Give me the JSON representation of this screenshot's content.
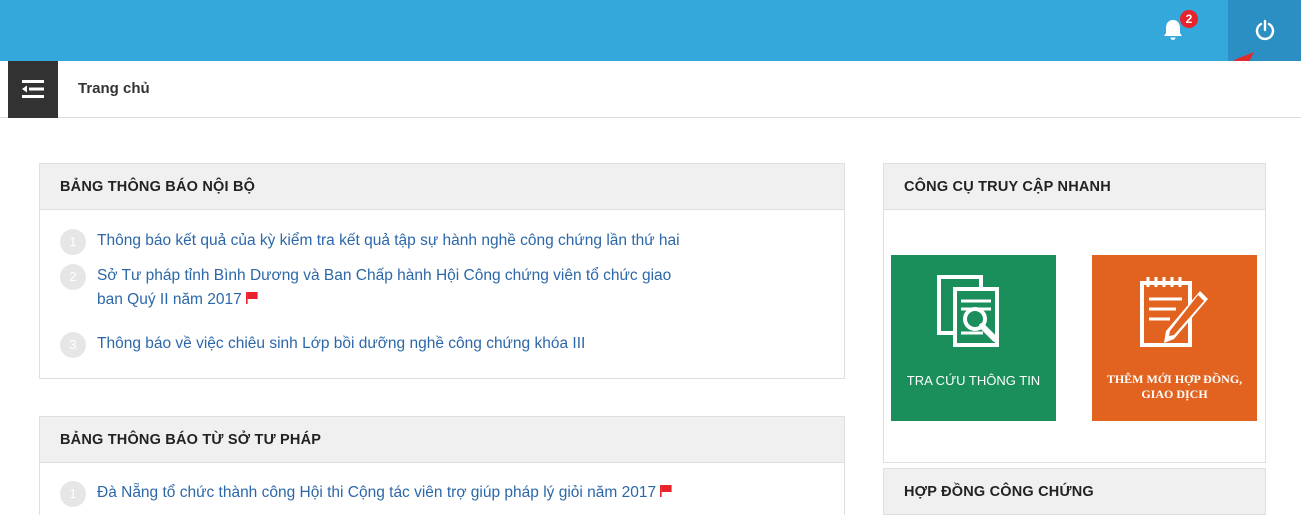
{
  "header": {
    "notification_count": "2"
  },
  "breadcrumb": {
    "title": "Trang chủ"
  },
  "internal_board": {
    "title": "BẢNG THÔNG BÁO NỘI BỘ",
    "items": [
      {
        "num": "1",
        "text": "Thông báo kết quả của kỳ kiểm tra kết quả tập sự hành nghề công chứng lần thứ hai",
        "new": false
      },
      {
        "num": "2",
        "text_line1": "Sở Tư pháp tỉnh Bình Dương và Ban Chấp hành Hội Công chứng viên tổ chức giao",
        "text_line2": "ban Quý II năm 2017",
        "new": true
      },
      {
        "num": "3",
        "text": "Thông báo về việc chiêu sinh Lớp bồi dưỡng nghề công chứng khóa III",
        "new": false
      }
    ]
  },
  "justice_board": {
    "title": "BẢNG THÔNG BÁO TỪ SỞ TƯ PHÁP",
    "items": [
      {
        "num": "1",
        "text": "Đà Nẵng tổ chức thành công Hội thi Cộng tác viên trợ giúp pháp lý giỏi năm 2017",
        "new": true
      }
    ]
  },
  "quick_tools": {
    "title": "CÔNG CỤ TRUY CẬP NHANH",
    "tiles": [
      {
        "label": "TRA CỨU THÔNG TIN",
        "icon": "document-search-icon",
        "color": "#1a8e5b"
      },
      {
        "label_line1": "THÊM MỚI HỢP ĐỒNG,",
        "label_line2": "GIAO DỊCH",
        "icon": "notepad-pencil-icon",
        "color": "#e1631f"
      }
    ]
  },
  "notarized_contracts": {
    "title": "HỢP ĐỒNG CÔNG CHỨNG"
  },
  "colors": {
    "topbar": "#35a8db",
    "link": "#2c67a8",
    "flag": "#e8232b"
  }
}
